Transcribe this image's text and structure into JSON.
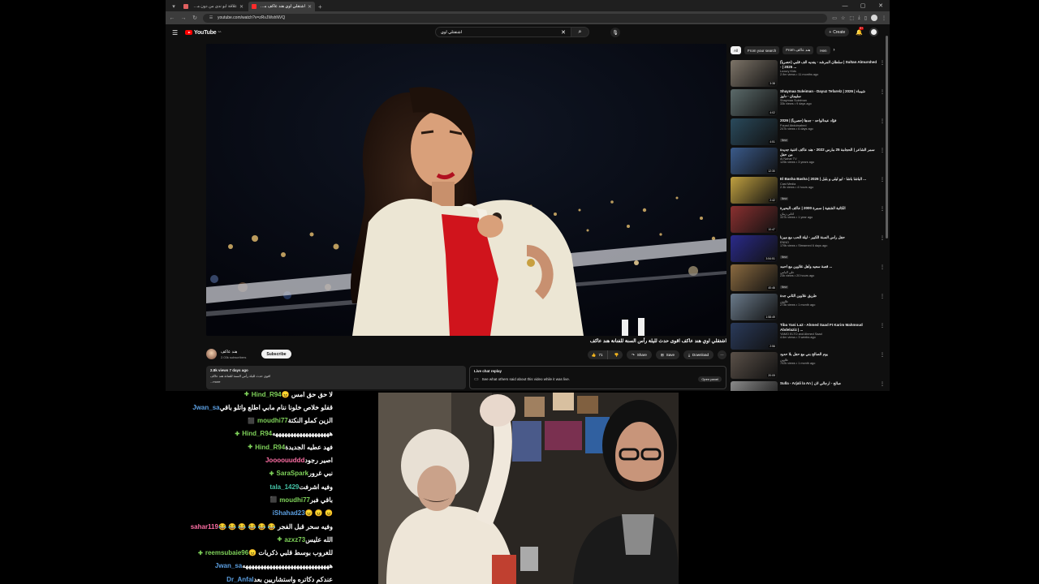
{
  "browser": {
    "tabs": [
      {
        "title": "علاقة ابو ندى من دون مسلم ولا ... ثانيه live.tv",
        "color": "#e06060"
      },
      {
        "title": "اشتقلي اوي هند عاكف مكانك (4537)",
        "color": "#ff2b2b"
      }
    ],
    "new_tab": "+",
    "url": "youtube.com/watch?v=zRvJWshNVQ"
  },
  "youtube": {
    "logo": "YouTube",
    "country": "SA",
    "search_query": "اشتقتلي اوي",
    "create_label": "Create",
    "notif_count": "9+",
    "video": {
      "title": "اشتقلي اوي هند عاكف اقوى حدث لليلة رأس السنة للفنانة هند عاكف",
      "channel": "هند عاكف",
      "subscribers": "2.03k subscribers",
      "subscribe": "Subscribe",
      "likes": "71",
      "share": "Share",
      "save": "Save",
      "download": "Download",
      "views_date": "2.8k views  7 days ago",
      "desc_line1": "اقوى حدث لليلة رأس السنة للفنانة هند عاكف",
      "desc_line2": "...more",
      "live_chat_title": "Live chat replay",
      "live_chat_text": "See what others said about this video while it was live.",
      "open_panel": "Open panel"
    },
    "chips": [
      "All",
      "From your search",
      "From هند عاكف",
      "Hen"
    ],
    "suggestions": [
      {
        "title": "سلطان المرشد - يفديه الف قلبي (حصرياً) | Sultan Almurshed - | 2025 ...",
        "channel": "Luxury Kids",
        "views": "2.9m views • 11 months ago",
        "duration": "3:38",
        "badge": ""
      },
      {
        "title": "Shaymaa Suleiman - Dayuz Tefarelz | 2026 | شيماء سليمان - دلوز",
        "channel": "Shaymaa Suleiman",
        "views": "33k views • 9 days ago",
        "duration": "4:02",
        "badge": ""
      },
      {
        "title": "فؤاد عبدالواحد - جدها (حصرياً) | 2026",
        "channel": "Fouad Abdulwahed",
        "views": "247k views • 6 days ago",
        "duration": "4:51",
        "badge": "New"
      },
      {
        "title": "سمر الشاعر | الحجامة 25 مارس 2022 - هند عاكف اغنية جديدة من حفل",
        "channel": "Al Nahar TV",
        "views": "125k views • 3 years ago",
        "duration": "12:30",
        "badge": ""
      },
      {
        "title": "El Basha Basha | 2026 | الباشا باشا - ابو ليلى و بلبل ...",
        "channel": "Cast Media",
        "views": "2.3k views • 4 hours ago",
        "duration": "2:42",
        "badge": "New"
      },
      {
        "title": "الكاتبة الشقية | سمرة 2000 | عاكف البحيرة",
        "channel": "اغاني زمان",
        "views": "337k views • 1 year ago",
        "duration": "10:47",
        "badge": ""
      },
      {
        "title": "حفل رأس السنة الكبير - ليلة الحب مع ميرنا",
        "channel": "ENNO",
        "views": "179k views • Streamed 6 days ago",
        "duration": "3:54:51",
        "badge": "New"
      },
      {
        "title": "قصة سعيد وأهل غلاوين مع احمد ...",
        "channel": "علي اليامي",
        "views": "23k views • 20 hours ago",
        "duration": "40:46",
        "badge": "New"
      },
      {
        "title": "طريق علاوين الثاني جدة",
        "channel": "علاوين",
        "views": "273k views • 1 month ago",
        "duration": "1:58:49",
        "badge": ""
      },
      {
        "title": "Tiba Yani La2 - Ahmed Saad Ft Karim Mahmoud Abdelaziz | ...",
        "channel": "YAMO ELTO and Ahmed Saad",
        "views": "4.6m views • 3 weeks ago",
        "duration": "2:56",
        "badge": ""
      },
      {
        "title": "يوم الصالح بني مع حفل بلا حدود",
        "channel": "علاوين",
        "views": "702k views • 1 month ago",
        "duration": "20:09",
        "badge": ""
      },
      {
        "title": "Sulla - Arjali la An | صالح - ارجالي لان",
        "channel": "",
        "views": "",
        "duration": "",
        "badge": ""
      }
    ]
  },
  "chat": [
    {
      "user": "Hind_R94",
      "color": "#7fd25a",
      "badge": "✚",
      "msg": "لا حق حق امس 😠"
    },
    {
      "user": "Jwan_sa",
      "color": "#5b9ee0",
      "badge": "",
      "msg": "قفلو خلاص خلونا ننام مابي اطلع واتلو باقي"
    },
    {
      "user": "moudhi77",
      "color": "#7fd25a",
      "badge": "⬛",
      "msg": "الزين كملو النكتة"
    },
    {
      "user": "Hind_R94",
      "color": "#7fd25a",
      "badge": "✚",
      "msg": "هههههههههههههههههههه"
    },
    {
      "user": "Hind_R94",
      "color": "#7fd25a",
      "badge": "✚",
      "msg": "فهد عطيه الجديدة"
    },
    {
      "user": "Joooouuddd",
      "color": "#ff6fa5",
      "badge": "",
      "msg": "اصير رجود"
    },
    {
      "user": "SaraSpark",
      "color": "#7fd25a",
      "badge": "✚",
      "msg": "نبي غرور"
    },
    {
      "user": "tala_1429",
      "color": "#44c2a6",
      "badge": "",
      "msg": "وفيه اشرفت"
    },
    {
      "user": "moudhi77",
      "color": "#7fd25a",
      "badge": "⬛",
      "msg": "باقي فبر"
    },
    {
      "user": "iShahad23",
      "color": "#5b9ee0",
      "badge": "",
      "msg": "😠 😠 😠"
    },
    {
      "user": "sahar119",
      "color": "#ff6fa5",
      "badge": "",
      "msg": "وفيه سحر قبل الفجر 😂 😂 😂 😂 😂 😂"
    },
    {
      "user": "azxz73",
      "color": "#7fd25a",
      "badge": "✚",
      "msg": "الله عليس"
    },
    {
      "user": "reemsubaie96",
      "color": "#7fd25a",
      "badge": "✚",
      "msg": "للغروب بوسط قلبي ذكريات 😠"
    },
    {
      "user": "Jwan_sa",
      "color": "#5b9ee0",
      "badge": "",
      "msg": "هههههههههههههههههههههههههههههه"
    },
    {
      "user": "Dr_Anfal",
      "color": "#5b9ee0",
      "badge": "",
      "msg": "عندكم دكاتره واستشاريين بعد"
    }
  ]
}
